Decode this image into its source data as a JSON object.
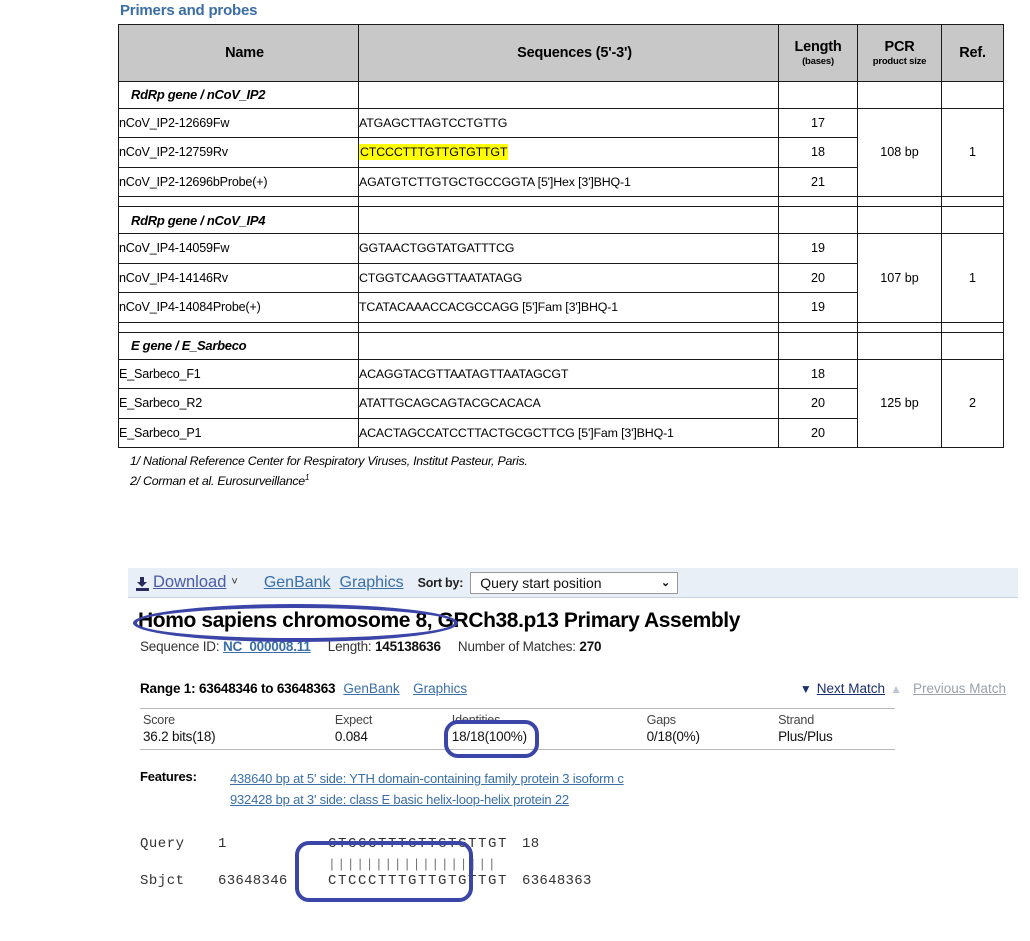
{
  "primers": {
    "heading": "Primers and probes",
    "columns": {
      "name": "Name",
      "sequences": "Sequences (5'-3')",
      "length": "Length",
      "length_sub": "(bases)",
      "pcr": "PCR",
      "pcr_sub": "product size",
      "ref": "Ref."
    },
    "groups": [
      {
        "title": "RdRp gene / nCoV_IP2",
        "pcr_product_size": "108 bp",
        "ref": "1",
        "rows": [
          {
            "name": "nCoV_IP2-12669Fw",
            "sequence": "ATGAGCTTAGTCCTGTTG",
            "length": "17",
            "highlighted": false
          },
          {
            "name": "nCoV_IP2-12759Rv",
            "sequence": "CTCCCTTTGTTGTGTTGT",
            "length": "18",
            "highlighted": true
          },
          {
            "name": "nCoV_IP2-12696bProbe(+)",
            "sequence": "AGATGTCTTGTGCTGCCGGTA [5']Hex [3']BHQ-1",
            "length": "21",
            "highlighted": false
          }
        ]
      },
      {
        "title": "RdRp gene / nCoV_IP4",
        "pcr_product_size": "107 bp",
        "ref": "1",
        "rows": [
          {
            "name": "nCoV_IP4-14059Fw",
            "sequence": "GGTAACTGGTATGATTTCG",
            "length": "19",
            "highlighted": false
          },
          {
            "name": "nCoV_IP4-14146Rv",
            "sequence": "CTGGTCAAGGTTAATATAGG",
            "length": "20",
            "highlighted": false
          },
          {
            "name": "nCoV_IP4-14084Probe(+)",
            "sequence": "TCATACAAACCACGCCAGG [5']Fam [3']BHQ-1",
            "length": "19",
            "highlighted": false
          }
        ]
      },
      {
        "title": "E gene / E_Sarbeco",
        "pcr_product_size": "125 bp",
        "ref": "2",
        "rows": [
          {
            "name": "E_Sarbeco_F1",
            "sequence": "ACAGGTACGTTAATAGTTAATAGCGT",
            "length": "18",
            "highlighted": false
          },
          {
            "name": "E_Sarbeco_R2",
            "sequence": "ATATTGCAGCAGTACGCACACA",
            "length": "20",
            "highlighted": false
          },
          {
            "name": "E_Sarbeco_P1",
            "sequence": "ACACTAGCCATCCTTACTGCGCTTCG [5']Fam [3']BHQ-1",
            "length": "20",
            "highlighted": false
          }
        ]
      }
    ],
    "footnotes": [
      "1/ National Reference Center for Respiratory Viruses, Institut Pasteur, Paris.",
      "2/ Corman et al. Eurosurveillance"
    ],
    "footnote2_superscript": "1",
    "highlight_color": "#ffff00",
    "heading_color": "#3a6ea5",
    "header_bg": "#c8c8c8"
  },
  "blast": {
    "toolbar": {
      "download_label": "Download",
      "download_caret": "˅",
      "genbank_label": "GenBank",
      "graphics_label": "Graphics",
      "sort_by_label": "Sort by:",
      "sort_value": "Query start position",
      "sort_caret": "⌄"
    },
    "title_highlighted": "Homo sapiens chromosome 8,",
    "title_rest": " GRCh38.p13 Primary Assembly",
    "sequence_id_label": "Sequence ID:",
    "sequence_id_value": "NC_000008.11",
    "length_label": "Length:",
    "length_value": "145138636",
    "matches_label": "Number of Matches:",
    "matches_value": "270",
    "range_text": "Range 1: 63648346 to 63648363",
    "range_genbank": "GenBank",
    "range_graphics": "Graphics",
    "next_match": "Next Match",
    "previous_match": "Previous Match",
    "next_match_triangle": "▼",
    "previous_match_triangle": "▲",
    "stats": {
      "score_label": "Score",
      "score_value": "36.2 bits(18)",
      "expect_label": "Expect",
      "expect_value": "0.084",
      "identities_label": "Identities",
      "identities_value": "18/18(100%)",
      "gaps_label": "Gaps",
      "gaps_value": "0/18(0%)",
      "strand_label": "Strand",
      "strand_value": "Plus/Plus"
    },
    "features_label": "Features:",
    "features": [
      "438640 bp at 5' side: YTH domain-containing family protein 3 isoform c",
      "932428 bp at 3' side: class E basic helix-loop-helix protein 22"
    ],
    "alignment": {
      "query_label": "Query",
      "query_start": "1",
      "query_seq": "CTCCCTTTGTTGTGTTGT",
      "query_end": "18",
      "match_bars": "||||||||||||||||||",
      "sbjct_label": "Sbjct",
      "sbjct_start": "63648346",
      "sbjct_seq": "CTCCCTTTGTTGTGTTGT",
      "sbjct_end": "63648363"
    },
    "annotation_color": "#3b45a8",
    "link_color": "#3a6fa8",
    "toolbar_bg": "#e8eff7"
  }
}
